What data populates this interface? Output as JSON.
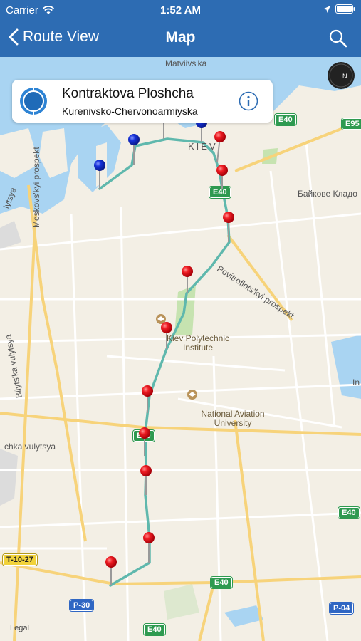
{
  "status": {
    "carrier": "Carrier",
    "time": "1:52 AM"
  },
  "nav": {
    "back_label": "Route View",
    "title": "Map"
  },
  "callout": {
    "stop_name": "Kontraktova Ploshcha",
    "route_name": "Kurenivsko-Chervonoarmiyska"
  },
  "map_labels": {
    "matviivs": "Matviivs'ka",
    "kiev": "KIEV",
    "moskovskyi": "Moskovs'kyi prospekt",
    "bilyts": "Bilyts'ka vulytsya",
    "povitroflots": "Povitroflots'kyi prospekt",
    "baikove": "Байкове Кладо",
    "lytsya": "lytsya",
    "vulytsya": "chka vulytsya",
    "i_n": "In",
    "polytechnic": "Kiev Polytechnic Institute",
    "aviation": "National Aviation University"
  },
  "road_shields": [
    {
      "label": "E40",
      "style": "green"
    },
    {
      "label": "E95",
      "style": "green"
    },
    {
      "label": "E40",
      "style": "green"
    },
    {
      "label": "E40",
      "style": "green"
    },
    {
      "label": "E40",
      "style": "green"
    },
    {
      "label": "E40",
      "style": "green"
    },
    {
      "label": "E40",
      "style": "green"
    },
    {
      "label": "T-10-27",
      "style": "yellow"
    },
    {
      "label": "P-30",
      "style": "blue"
    },
    {
      "label": "P-04",
      "style": "blue"
    }
  ],
  "legal": "Legal",
  "icons": {
    "back": "chevron-left-icon",
    "search": "search-icon",
    "info": "info-icon",
    "compass": "compass-icon",
    "wifi": "wifi-icon",
    "location": "location-arrow-icon",
    "battery": "battery-icon"
  },
  "colors": {
    "nav_bar": "#2d6cb3",
    "route_line": "#5fb8ad",
    "pin_red": "#e8151b",
    "pin_blue": "#1531d6"
  }
}
